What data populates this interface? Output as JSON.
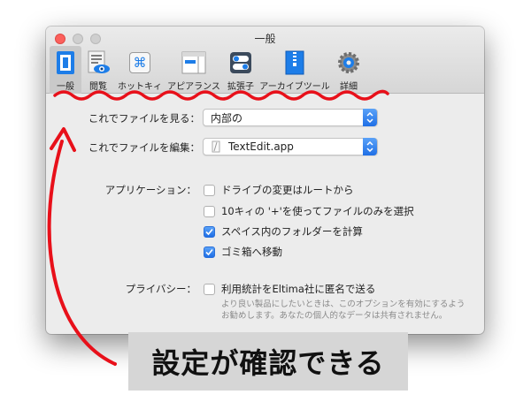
{
  "window": {
    "title": "一般"
  },
  "toolbar": {
    "items": [
      {
        "label": "一般",
        "selected": true
      },
      {
        "label": "閲覧"
      },
      {
        "label": "ホットキィ"
      },
      {
        "label": "アピアランス"
      },
      {
        "label": "拡張子"
      },
      {
        "label": "アーカイブツール"
      },
      {
        "label": "詳細"
      }
    ],
    "hotkey_glyph": "⌘"
  },
  "form": {
    "view_label": "これでファイルを見る：",
    "view_value": "内部の",
    "edit_label": "これでファイルを編集：",
    "edit_value": "TextEdit.app",
    "app_label": "アプリケーション：",
    "app_options": [
      {
        "label": "ドライブの変更はルートから",
        "checked": false
      },
      {
        "label": "10キィの '+'を使ってファイルのみを選択",
        "checked": false
      },
      {
        "label": "スペイス内のフォルダーを計算",
        "checked": true
      },
      {
        "label": "ゴミ箱へ移動",
        "checked": true
      }
    ],
    "privacy_label": "プライバシー：",
    "privacy_option": {
      "label": "利用統計をEltima社に匿名で送る",
      "checked": false
    },
    "privacy_help_1": "より良い製品にしたいときは、このオプションを有効にするよう",
    "privacy_help_2": "お勧めします。あなたの個人的なデータは共有されません。"
  },
  "annotation": {
    "caption": "設定が確認できる",
    "accent_color": "#e8101a"
  },
  "colors": {
    "accent_blue": "#1f6fe6",
    "close_red": "#fc605c"
  }
}
